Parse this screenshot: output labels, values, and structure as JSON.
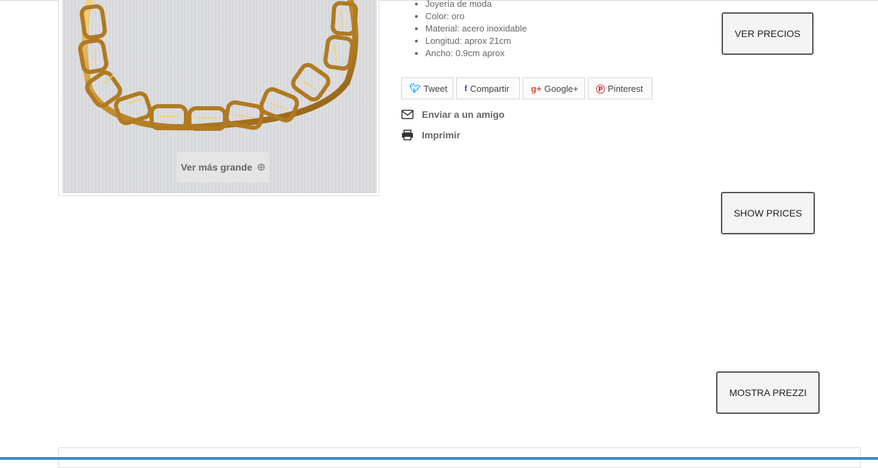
{
  "product": {
    "zoom_label": "Ver más grande",
    "features": [
      "Joyería de moda",
      "Color: oro",
      "Material: acero inoxidable",
      "Longitud: aprox 21cm",
      "Ancho: 0.9cm aprox"
    ]
  },
  "social": {
    "tweet": "Tweet",
    "share": "Compartir",
    "google": "Google+",
    "pinterest": "Pinterest"
  },
  "actions": {
    "send_friend": "Enviar a un amigo",
    "print": "Imprimir"
  },
  "price_buttons": {
    "es": "VER PRECIOS",
    "en": "SHOW PRICES",
    "it": "MOSTRA PREZZI"
  },
  "icons": {
    "zoom": "zoom-in-icon",
    "twitter": "twitter-icon",
    "facebook": "facebook-icon",
    "google": "google-plus-icon",
    "pinterest": "pinterest-icon",
    "mail": "envelope-icon",
    "print": "printer-icon"
  },
  "colors": {
    "twitter": "#1da1f2",
    "facebook": "#3b5998",
    "google": "#dd4b39",
    "pinterest": "#cb2027",
    "gold": "#c8902e"
  }
}
